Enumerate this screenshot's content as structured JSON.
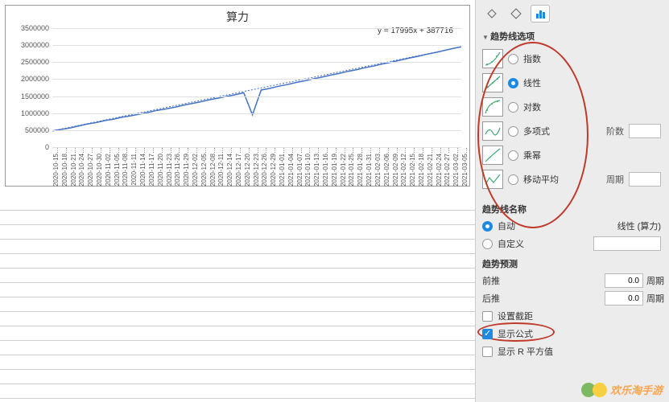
{
  "chart_data": {
    "type": "line",
    "title": "算力",
    "xlabel": "",
    "ylabel": "",
    "ylim": [
      0,
      3500000
    ],
    "y_ticks": [
      0,
      500000,
      1000000,
      1500000,
      2000000,
      2500000,
      3000000,
      3500000
    ],
    "categories": [
      "2020-10-15…",
      "2020-10-18…",
      "2020-10-21…",
      "2020-10-24…",
      "2020-10-27…",
      "2020-10-30…",
      "2020-11-02…",
      "2020-11-05…",
      "2020-11-08…",
      "2020-11-11…",
      "2020-11-14…",
      "2020-11-17…",
      "2020-11-20…",
      "2020-11-23…",
      "2020-11-26…",
      "2020-11-29…",
      "2020-12-02…",
      "2020-12-05…",
      "2020-12-08…",
      "2020-12-11…",
      "2020-12-14…",
      "2020-12-17…",
      "2020-12-20…",
      "2020-12-23…",
      "2020-12-26…",
      "2020-12-29…",
      "2021-01-01…",
      "2021-01-04…",
      "2021-01-07…",
      "2021-01-10…",
      "2021-01-13…",
      "2021-01-16…",
      "2021-01-19…",
      "2021-01-22…",
      "2021-01-25…",
      "2021-01-28…",
      "2021-01-31…",
      "2021-02-03…",
      "2021-02-06…",
      "2021-02-09…",
      "2021-02-12…",
      "2021-02-15…",
      "2021-02-18…",
      "2021-02-21…",
      "2021-02-24…",
      "2021-02-27…",
      "2021-03-02…",
      "2021-03-05…"
    ],
    "series": [
      {
        "name": "算力",
        "values": [
          480000,
          520000,
          560000,
          620000,
          680000,
          720000,
          780000,
          820000,
          880000,
          920000,
          970000,
          1020000,
          1080000,
          1120000,
          1170000,
          1230000,
          1280000,
          1330000,
          1390000,
          1440000,
          1490000,
          1540000,
          1600000,
          950000,
          1680000,
          1730000,
          1790000,
          1840000,
          1900000,
          1950000,
          2010000,
          2060000,
          2120000,
          2170000,
          2230000,
          2280000,
          2340000,
          2390000,
          2450000,
          2500000,
          2560000,
          2620000,
          2670000,
          2730000,
          2780000,
          2840000,
          2900000,
          2950000
        ]
      }
    ],
    "trendline": {
      "type": "linear",
      "equation": "y = 17995x + 387716"
    }
  },
  "sidepanel": {
    "section_trendline": "趋势线选项",
    "options": {
      "exponential": "指数",
      "linear": "线性",
      "logarithmic": "对数",
      "polynomial": "多项式",
      "power": "乘幂",
      "moving_avg": "移动平均"
    },
    "selected": "linear",
    "poly_order_label": "阶数",
    "period_label": "周期",
    "name_section": "趋势线名称",
    "name_auto": "自动",
    "name_custom": "自定义",
    "name_preview": "线性 (算力)",
    "forecast_section": "趋势预测",
    "forward": "前推",
    "backward": "后推",
    "forward_val": "0.0",
    "backward_val": "0.0",
    "period_unit": "周期",
    "set_intercept": "设置截距",
    "show_equation": "显示公式",
    "show_r2": "显示 R 平方值"
  },
  "watermark": "欢乐淘手游"
}
